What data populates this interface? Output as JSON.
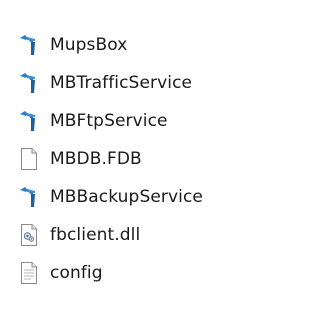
{
  "files": [
    {
      "name": "MupsBox",
      "icon": "app-executable-icon"
    },
    {
      "name": "MBTrafficService",
      "icon": "app-executable-icon"
    },
    {
      "name": "MBFtpService",
      "icon": "app-executable-icon"
    },
    {
      "name": "MBDB.FDB",
      "icon": "blank-file-icon"
    },
    {
      "name": "MBBackupService",
      "icon": "app-executable-icon"
    },
    {
      "name": "fbclient.dll",
      "icon": "dll-file-icon"
    },
    {
      "name": "config",
      "icon": "text-file-icon"
    }
  ]
}
